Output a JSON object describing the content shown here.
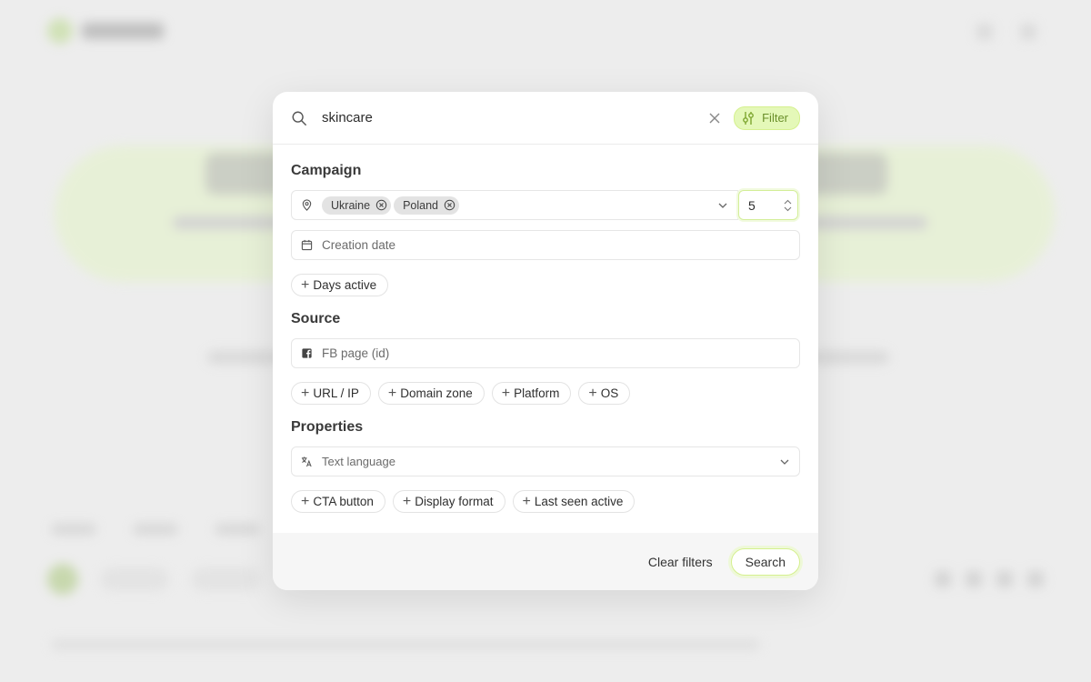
{
  "search": {
    "query": "skincare",
    "filter_label": "Filter"
  },
  "campaign": {
    "title": "Campaign",
    "locations": [
      "Ukraine",
      "Poland"
    ],
    "radius_value": "5",
    "creation_date_placeholder": "Creation date",
    "add_pills": [
      "Days active"
    ]
  },
  "source": {
    "title": "Source",
    "fb_page_placeholder": "FB page (id)",
    "add_pills": [
      "URL / IP",
      "Domain zone",
      "Platform",
      "OS"
    ]
  },
  "properties": {
    "title": "Properties",
    "text_language_placeholder": "Text language",
    "add_pills": [
      "CTA button",
      "Display format",
      "Last seen active"
    ]
  },
  "footer": {
    "clear_label": "Clear filters",
    "search_label": "Search"
  },
  "colors": {
    "accent_green": "#e4f8b8",
    "accent_green_text": "#6a8f2a"
  }
}
